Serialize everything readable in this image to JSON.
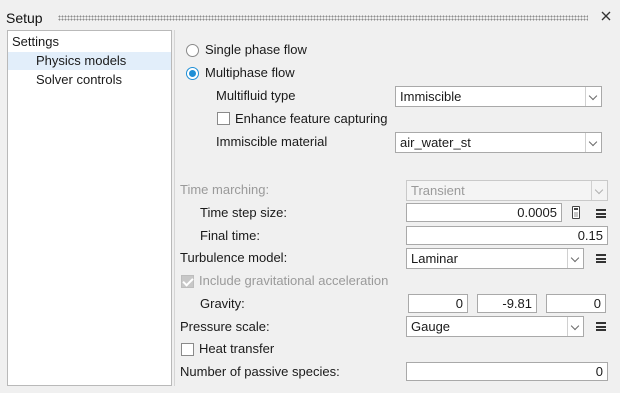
{
  "window": {
    "title": "Setup",
    "close_icon": "close-icon"
  },
  "tree": {
    "root": "Settings",
    "items": [
      {
        "label": "Physics models",
        "selected": true
      },
      {
        "label": "Solver controls",
        "selected": false
      }
    ]
  },
  "flow": {
    "single_label": "Single phase flow",
    "multi_label": "Multiphase flow",
    "selected": "multiphase"
  },
  "multifluid": {
    "type_label": "Multifluid type",
    "type_value": "Immiscible",
    "enhance_label": "Enhance feature capturing",
    "enhance_checked": false,
    "material_label": "Immiscible material",
    "material_value": "air_water_st"
  },
  "time": {
    "marching_label": "Time marching:",
    "marching_value": "Transient",
    "step_label": "Time step size:",
    "step_value": "0.0005",
    "final_label": "Final time:",
    "final_value": "0.15"
  },
  "turbulence": {
    "label": "Turbulence model:",
    "value": "Laminar"
  },
  "gravity": {
    "include_label": "Include gravitational acceleration",
    "include_checked": true,
    "label": "Gravity:",
    "x": "0",
    "y": "-9.81",
    "z": "0"
  },
  "pressure": {
    "label": "Pressure scale:",
    "value": "Gauge"
  },
  "heat": {
    "label": "Heat transfer",
    "checked": false
  },
  "species": {
    "label": "Number of passive species:",
    "value": "0"
  },
  "colors": {
    "accent": "#1f8fd6",
    "selection": "#e2eefa",
    "disabled_text": "#9a9a9a"
  }
}
